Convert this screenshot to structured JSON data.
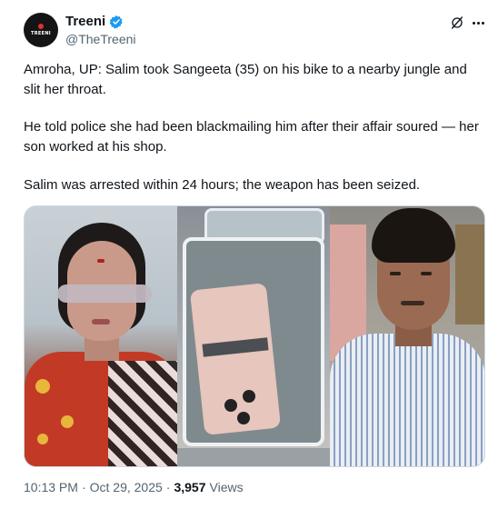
{
  "author": {
    "display_name": "Treeni",
    "handle": "@TheTreeni",
    "avatar_text": "TREENI",
    "verified": true,
    "verified_color": "#1d9bf0"
  },
  "header": {
    "grok_icon": "grok-icon",
    "more_icon": "more-horizontal-icon"
  },
  "tweet": {
    "paragraphs": [
      "Amroha, UP: Salim took Sangeeta (35) on his bike to a nearby jungle and slit her throat.",
      "He told police she had been blackmailing him after their affair soured — her son worked at his shop.",
      "Salim was arrested within 24 hours; the weapon has been seized."
    ]
  },
  "media": {
    "panel_count": 3
  },
  "footer": {
    "time": "10:13 PM",
    "separator1": "·",
    "date": "Oct 29, 2025",
    "separator2": "·",
    "views_count": "3,957",
    "views_label": "Views"
  },
  "colors": {
    "text_primary": "#0f1419",
    "text_secondary": "#536471",
    "border": "#cfd9de"
  }
}
